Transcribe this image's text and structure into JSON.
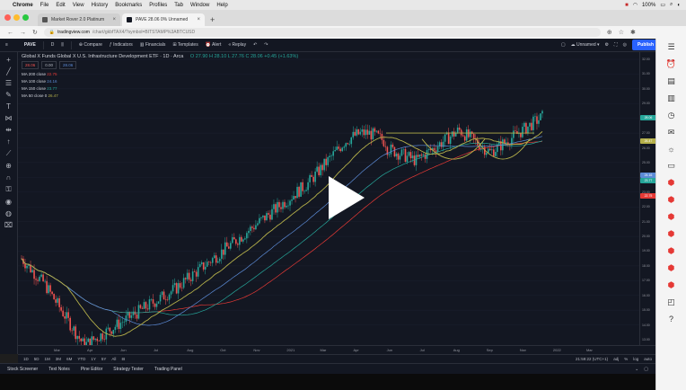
{
  "menubar": {
    "app": "Chrome",
    "items": [
      "File",
      "Edit",
      "View",
      "History",
      "Bookmarks",
      "Profiles",
      "Tab",
      "Window",
      "Help"
    ],
    "battery": "100%"
  },
  "tabs": [
    {
      "label": "Market Rover 2.0 Platinum",
      "active": false
    },
    {
      "label": "PAVE 28.06 0% Unnamed",
      "active": true
    }
  ],
  "address": {
    "host": "tradingview.com",
    "path": "/chart/gkbfTAX4/?symbol=BITSTAMP%3ABTCUSD"
  },
  "toolbar": {
    "symbol": "PAVE",
    "interval": "D",
    "compare": "Compare",
    "indicators": "Indicators",
    "financials": "Financials",
    "templates": "Templates",
    "alert": "Alert",
    "replay": "Replay",
    "layout_name": "Unnamed",
    "publish": "Publish"
  },
  "legend": {
    "title": "Global X Funds Global X U.S. Infrastructure Development ETF · 1D · Arca",
    "ohlc": "O 27.90  H 28.10  L 27.76  C 28.06  +0.45 (+1.63%)",
    "ma_lines": [
      {
        "label": "MA 200 close",
        "value": "22.75",
        "color": "#e53935"
      },
      {
        "label": "MA 100 close",
        "value": "24.16",
        "color": "#5c8bd6"
      },
      {
        "label": "MA 150 close",
        "value": "23.77",
        "color": "#26a69a"
      },
      {
        "label": "MA 50 close 0",
        "value": "26.47",
        "color": "#b5b04a"
      }
    ],
    "boxes": [
      "28.06",
      "0.00",
      "28.06"
    ]
  },
  "price_scale": {
    "ticks": [
      "32.00",
      "31.00",
      "30.00",
      "29.00",
      "28.00",
      "27.00",
      "26.00",
      "25.00",
      "24.00",
      "23.00",
      "22.00",
      "21.00",
      "20.00",
      "19.00",
      "18.00",
      "17.00",
      "16.00",
      "15.00",
      "14.00",
      "13.00"
    ],
    "last_price": "28.06",
    "labels": [
      {
        "text": "28.06",
        "color": "#26a69a"
      },
      {
        "text": "26.47",
        "color": "#b5b04a"
      },
      {
        "text": "24.16",
        "color": "#5c8bd6"
      },
      {
        "text": "23.77",
        "color": "#26a69a"
      },
      {
        "text": "22.75",
        "color": "#e53935"
      }
    ]
  },
  "time_axis": [
    "Mar",
    "Apr",
    "Jun",
    "Jul",
    "Aug",
    "Oct",
    "Nov",
    "2021",
    "Mar",
    "Apr",
    "Jun",
    "Jul",
    "Aug",
    "Sep",
    "Nov",
    "2022",
    "Mar"
  ],
  "timeframes": [
    "1D",
    "5D",
    "1M",
    "3M",
    "6M",
    "YTD",
    "1Y",
    "5Y",
    "All"
  ],
  "clock": "21:59:22 (UTC+1)",
  "scale_opts": [
    "adj",
    "%",
    "log",
    "auto"
  ],
  "panels": [
    "Stock Screener",
    "Text Notes",
    "Pine Editor",
    "Strategy Tester",
    "Trading Panel"
  ],
  "chart_data": {
    "type": "candlestick",
    "series": [
      {
        "name": "MA 200 close",
        "color": "#e53935"
      },
      {
        "name": "MA 100 close",
        "color": "#5c8bd6"
      },
      {
        "name": "MA 150 close",
        "color": "#26a69a"
      },
      {
        "name": "MA 50 close 0",
        "color": "#b5b04a"
      }
    ],
    "resistance": 27.0,
    "ylim": [
      13,
      32
    ]
  }
}
